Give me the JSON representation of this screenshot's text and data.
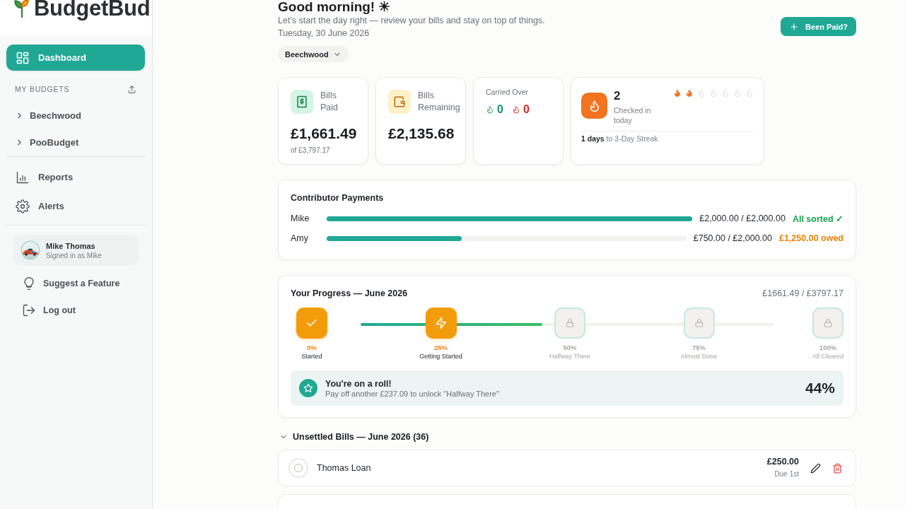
{
  "app": {
    "name": "BudgetBud"
  },
  "sidebar": {
    "nav": [
      {
        "label": "Dashboard",
        "selected": true
      }
    ],
    "budgets_heading": "MY BUDGETS",
    "budgets": [
      {
        "label": "Beechwood",
        "expanded": false
      },
      {
        "label": "PooBudget",
        "expanded": false
      }
    ],
    "links": [
      {
        "label": "Reports",
        "selected": false
      },
      {
        "label": "Alerts",
        "selected": false
      }
    ],
    "user": {
      "name": "Mike Thomas",
      "subtitle": "Signed in as Mike"
    },
    "footer_links": [
      {
        "label": "Suggest a Feature"
      },
      {
        "label": "Log out"
      }
    ]
  },
  "header": {
    "greeting": "Good morning! ☀",
    "subtitle": "Let's start the day right — review your bills and stay on top of things.",
    "date": "Tuesday, 30 June 2026",
    "budget_selector": "Beechwood",
    "action_button": "Been Paid?"
  },
  "stats": {
    "bills_paid": {
      "label": "Bills Paid",
      "amount": "£1,661.49",
      "note": "of £3,797.17"
    },
    "bills_remaining": {
      "label": "Bills Remaining",
      "amount": "£2,135.68"
    },
    "carried_over": {
      "label": "Carried Over",
      "counts": [
        {
          "kind": "good",
          "value": "0"
        },
        {
          "kind": "bad",
          "value": "0"
        }
      ]
    },
    "streak": {
      "count": "2",
      "label": "Checked in today",
      "footer": "**1 days** to 3-Day Streak",
      "days": [
        {
          "lit": true
        },
        {
          "lit": true
        },
        {
          "lit": false
        },
        {
          "lit": false
        },
        {
          "lit": false
        },
        {
          "lit": false
        },
        {
          "lit": false
        }
      ]
    }
  },
  "contributors": {
    "title": "Contributor Payments",
    "rows": [
      {
        "name": "Mike",
        "level": 1.0,
        "amount": "£2,000.00 / £2,000.00",
        "status": "All sorted ✓",
        "kind": "sorted"
      },
      {
        "name": "Amy",
        "level": 0.375,
        "amount": "£750.00 / £2,000.00",
        "status": "£1,250.00 owed",
        "kind": "owed"
      }
    ]
  },
  "progress": {
    "title": "Your Progress — June 2026",
    "total": "£1661.49 / £3797.17",
    "level": 0.44,
    "milestones": [
      {
        "percent": "0%",
        "label": "Started",
        "unlocked": true,
        "current": false
      },
      {
        "percent": "25%",
        "label": "Getting Started",
        "unlocked": true,
        "current": true
      },
      {
        "percent": "50%",
        "label": "Halfway There",
        "unlocked": false,
        "current": false
      },
      {
        "percent": "75%",
        "label": "Almost Done",
        "unlocked": false,
        "current": false
      },
      {
        "percent": "100%",
        "label": "All Cleared",
        "unlocked": false,
        "current": false
      }
    ],
    "callout": {
      "title": "You're on a roll!",
      "text": "Pay off another £237.09 to unlock \"Halfway There\"",
      "percent": "44%"
    }
  },
  "bills": {
    "heading": "Unsettled Bills — June 2026 (36)",
    "expanded": true,
    "items": [
      {
        "name": "Thomas Loan",
        "amount": "£250.00",
        "due": "Due 1st",
        "paid": false
      }
    ]
  }
}
